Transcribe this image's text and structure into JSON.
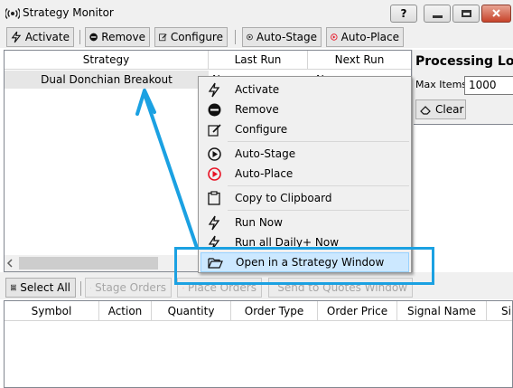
{
  "window": {
    "title": "Strategy Monitor",
    "help_label": "?"
  },
  "toolbar": {
    "activate": "Activate",
    "remove": "Remove",
    "configure": "Configure",
    "auto_stage": "Auto-Stage",
    "auto_place": "Auto-Place"
  },
  "grid": {
    "columns": [
      "Strategy",
      "Last Run",
      "Next Run"
    ],
    "rows": [
      {
        "strategy": "Dual Donchian Breakout",
        "last_run": "N",
        "next_run": "N"
      }
    ]
  },
  "processing_log": {
    "title": "Processing Log",
    "max_items_label": "Max Items:",
    "max_items_value": "1000",
    "clear_label": "Clear"
  },
  "bottom_toolbar": {
    "select_all": "Select All",
    "stage_orders": "Stage Orders",
    "place_orders": "Place Orders",
    "send_quotes": "Send to Quotes Window"
  },
  "orders_grid": {
    "columns": [
      "Symbol",
      "Action",
      "Quantity",
      "Order Type",
      "Order Price",
      "Signal Name",
      "Si"
    ]
  },
  "context_menu": {
    "items": [
      "Activate",
      "Remove",
      "Configure",
      "Auto-Stage",
      "Auto-Place",
      "Copy to Clipboard",
      "Run Now",
      "Run all Daily+ Now",
      "Open in a Strategy Window"
    ],
    "highlighted": "Open in a Strategy Window"
  },
  "colors": {
    "annotation": "#1ba1e2",
    "auto_place_red": "#e81123",
    "menu_highlight": "#cce8ff"
  }
}
